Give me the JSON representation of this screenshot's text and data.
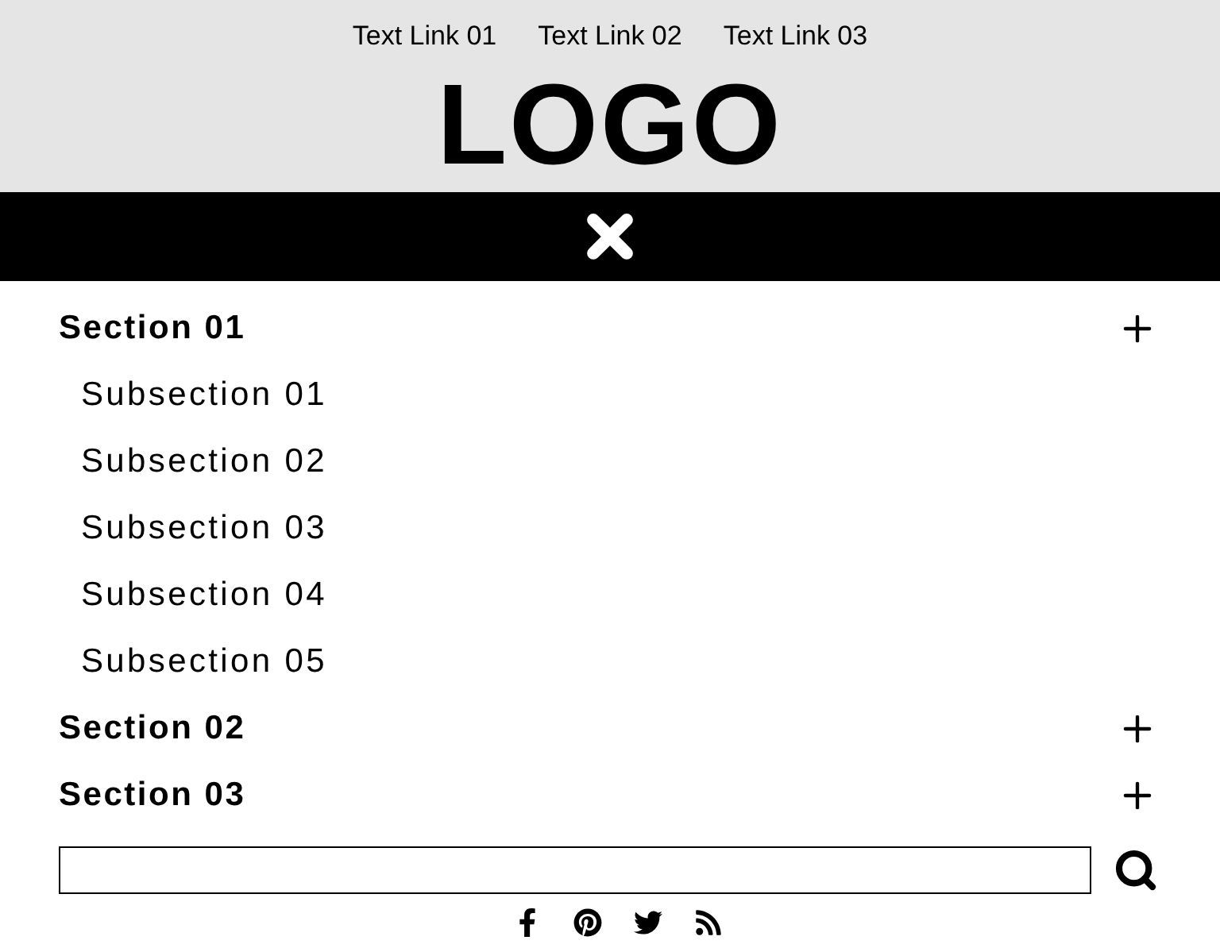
{
  "header": {
    "links": [
      "Text Link 01",
      "Text Link 02",
      "Text Link 03"
    ],
    "logo": "LOGO"
  },
  "menu": {
    "sections": [
      {
        "label": "Section 01",
        "children": [
          {
            "label": "Subsection 01"
          },
          {
            "label": "Subsection 02"
          },
          {
            "label": "Subsection 03"
          },
          {
            "label": "Subsection 04"
          },
          {
            "label": "Subsection 05"
          }
        ]
      },
      {
        "label": "Section 02"
      },
      {
        "label": "Section 03"
      }
    ]
  },
  "social": [
    {
      "kind": "facebook"
    },
    {
      "kind": "pinterest"
    },
    {
      "kind": "twitter"
    },
    {
      "kind": "rss"
    }
  ]
}
